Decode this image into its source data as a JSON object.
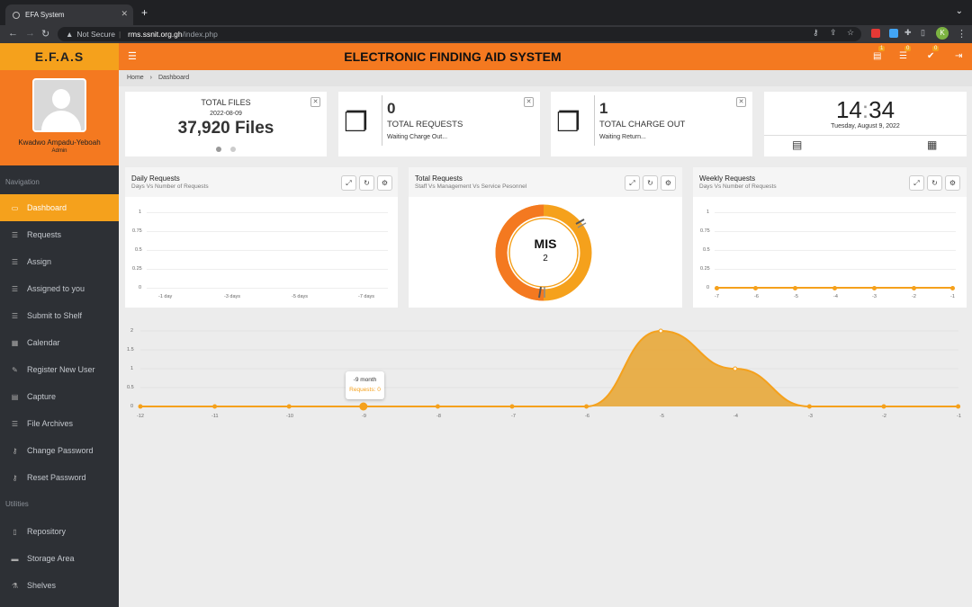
{
  "browser": {
    "tab_title": "EFA System",
    "security": "Not Secure",
    "url_host": "rms.ssnit.org.gh",
    "url_path": "/index.php",
    "profile_initial": "K"
  },
  "brand": "E.F.A.S",
  "app_title": "ELECTRONIC FINDING AID SYSTEM",
  "user": {
    "name": "Kwadwo Ampadu-Yeboah",
    "role": "Admin"
  },
  "nav_section": "Navigation",
  "nav_items": [
    "Dashboard",
    "Requests",
    "Assign",
    "Assigned to you",
    "Submit to Shelf",
    "Calendar",
    "Register New User",
    "Capture",
    "File Archives",
    "Change Password",
    "Reset Password"
  ],
  "util_section": "Utilities",
  "util_items": [
    "Repository",
    "Storage Area",
    "Shelves"
  ],
  "top_badges": [
    "1",
    "0",
    "0"
  ],
  "breadcrumb": {
    "home": "Home",
    "current": "Dashboard"
  },
  "total_files": {
    "label": "TOTAL FILES",
    "date": "2022-08-09",
    "value": "37,920 Files"
  },
  "total_requests": {
    "value": "0",
    "label": "TOTAL REQUESTS",
    "sub": "Waiting Charge Out..."
  },
  "charge_out": {
    "value": "1",
    "label": "TOTAL CHARGE OUT",
    "sub": "Waiting Return..."
  },
  "clock": {
    "hour": "14",
    "sep": ":",
    "minute": "34",
    "date": "Tuesday, August 9, 2022"
  },
  "daily": {
    "title": "Daily Requests",
    "subtitle": "Days Vs Number of Requests",
    "y": [
      "1",
      "0.75",
      "0.5",
      "0.25",
      "0"
    ],
    "x": [
      "-1 day",
      "-3 days",
      "-5 days",
      "-7 days"
    ]
  },
  "donut": {
    "title": "Total Requests",
    "subtitle": "Staff Vs Management Vs Service Pesonnel",
    "label": "MIS",
    "value": "2"
  },
  "weekly": {
    "title": "Weekly Requests",
    "subtitle": "Days Vs Number of Requests",
    "y": [
      "1",
      "0.75",
      "0.5",
      "0.25",
      "0"
    ],
    "x": [
      "-7",
      "-6",
      "-5",
      "-4",
      "-3",
      "-2",
      "-1"
    ]
  },
  "monthly": {
    "y": [
      "2",
      "1.5",
      "1",
      "0.5",
      "0"
    ],
    "x": [
      "-12",
      "-11",
      "-10",
      "-9",
      "-8",
      "-7",
      "-6",
      "-5",
      "-4",
      "-3",
      "-2",
      "-1"
    ],
    "tooltip_title": "-9 month",
    "tooltip_value": "Requests: 0"
  },
  "colors": {
    "orange": "#f47920",
    "amber": "#f5a11c",
    "sidebar": "#2d3035"
  },
  "chart_data": [
    {
      "type": "line",
      "title": "Daily Requests",
      "xlabel": "",
      "ylabel": "",
      "x": [
        "-1 day",
        "-3 days",
        "-5 days",
        "-7 days"
      ],
      "series": [],
      "ylim": [
        0,
        1
      ]
    },
    {
      "type": "pie",
      "title": "Total Requests",
      "categories": [
        "MIS"
      ],
      "values": [
        2
      ]
    },
    {
      "type": "line",
      "title": "Weekly Requests",
      "x": [
        "-7",
        "-6",
        "-5",
        "-4",
        "-3",
        "-2",
        "-1"
      ],
      "series": [
        {
          "values": [
            0,
            0,
            0,
            0,
            0,
            0,
            0
          ]
        }
      ],
      "ylim": [
        0,
        1
      ]
    },
    {
      "type": "area",
      "title": "",
      "x": [
        "-12",
        "-11",
        "-10",
        "-9",
        "-8",
        "-7",
        "-6",
        "-5",
        "-4",
        "-3",
        "-2",
        "-1"
      ],
      "series": [
        {
          "name": "Requests",
          "values": [
            0,
            0,
            0,
            0,
            0,
            0,
            0,
            2,
            1,
            0,
            0,
            0
          ]
        }
      ],
      "ylim": [
        0,
        2
      ]
    }
  ]
}
